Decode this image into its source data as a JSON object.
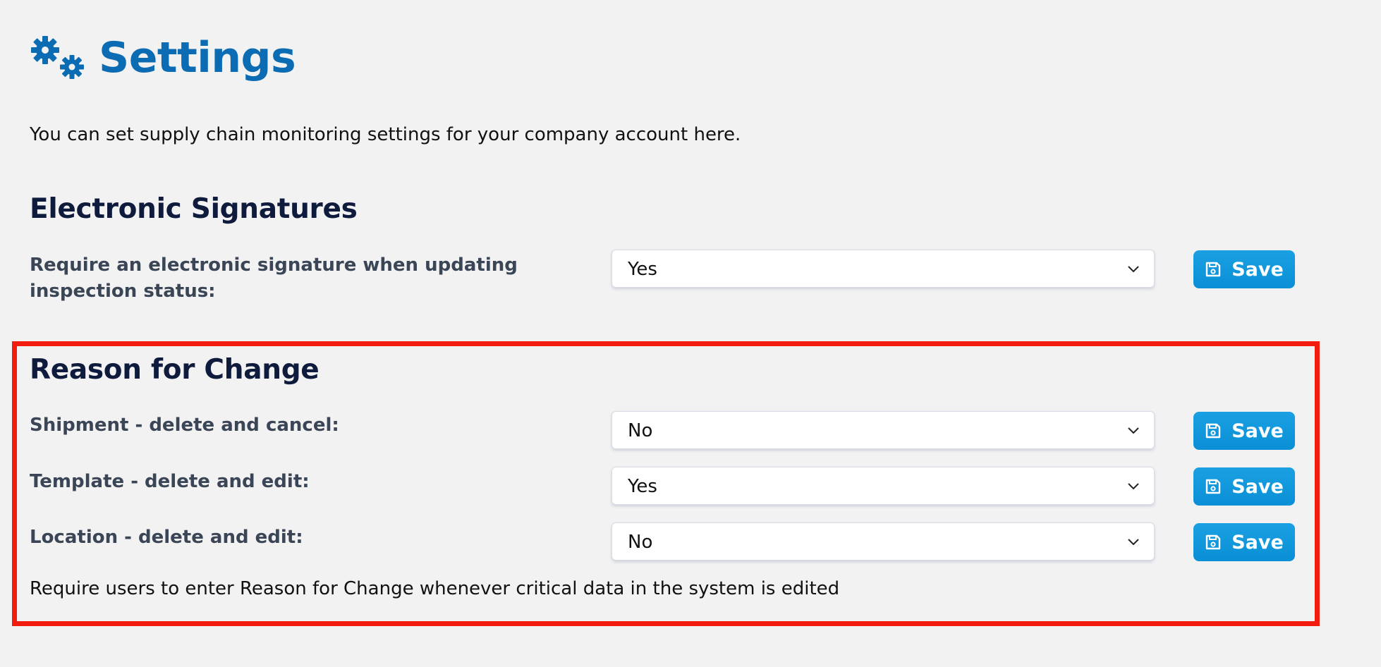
{
  "header": {
    "icon": "gears-icon",
    "title": "Settings",
    "intro": "You can set supply chain monitoring settings for your company account here."
  },
  "electronic_signatures": {
    "title": "Electronic Signatures",
    "rows": [
      {
        "label": "Require an electronic signature when updating inspection status:",
        "value": "Yes",
        "save_label": "Save"
      }
    ]
  },
  "reason_for_change": {
    "title": "Reason for Change",
    "rows": [
      {
        "label": "Shipment - delete and cancel:",
        "value": "No",
        "save_label": "Save"
      },
      {
        "label": "Template - delete and edit:",
        "value": "Yes",
        "save_label": "Save"
      },
      {
        "label": "Location - delete and edit:",
        "value": "No",
        "save_label": "Save"
      }
    ],
    "note": "Require users to enter Reason for Change whenever critical data in the system is edited"
  },
  "colors": {
    "title_blue": "#0b6bb3",
    "button_blue": "#1aa0e2",
    "highlight_red": "#f21c0f",
    "background": "#f2f2f2"
  }
}
